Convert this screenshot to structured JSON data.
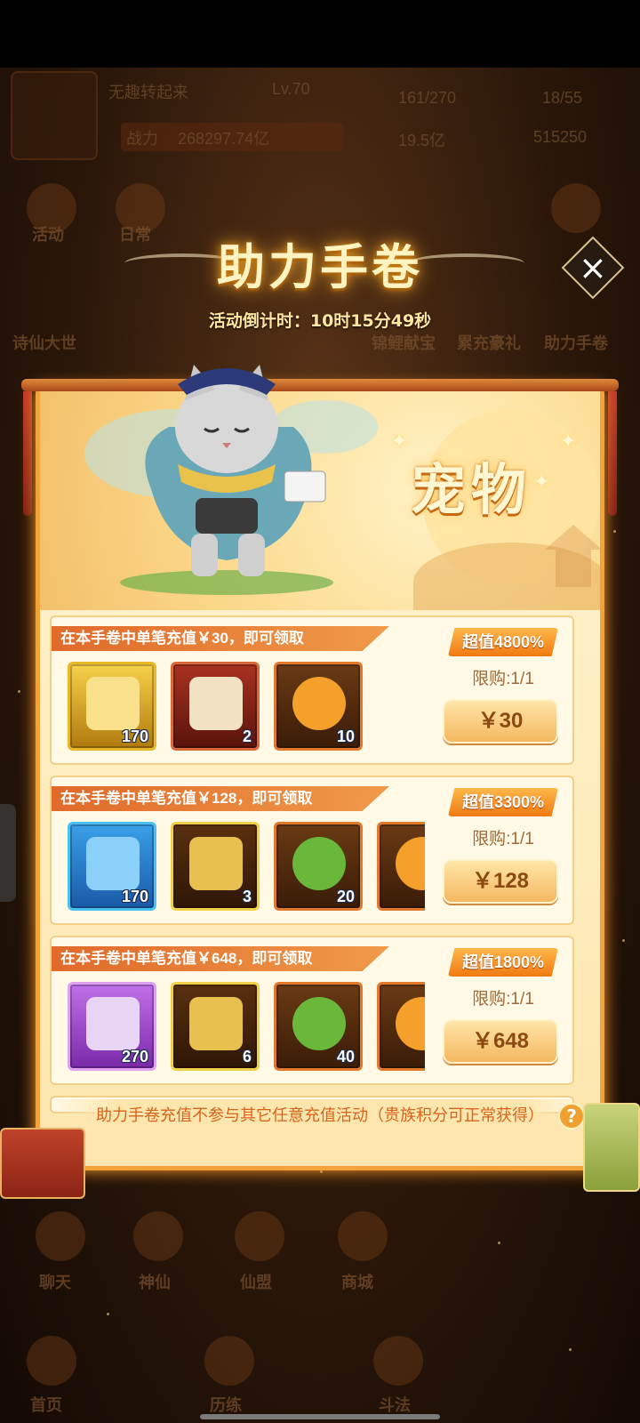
{
  "hud": {
    "player_name": "无趣转起来",
    "level": "Lv.70",
    "stamina": "161/270",
    "energy": "18/55",
    "power_label": "战力",
    "power_value": "268297.74亿",
    "currency_1": "19.5亿",
    "currency_2": "515250"
  },
  "background_labels": [
    "活动",
    "日常",
    "诗仙大世",
    "锦鲤献宝",
    "累充豪礼",
    "助力手卷",
    "聊天",
    "神仙",
    "仙盟",
    "商城",
    "首页",
    "历练",
    "斗法"
  ],
  "popup": {
    "title": "助力手卷",
    "countdown_label": "活动倒计时：",
    "countdown_value": "10时15分49秒",
    "close_icon": "×",
    "category": "宠物",
    "footer_note": "助力手卷充值不参与其它任意充值活动（贵族积分可正常获得）",
    "help_icon": "?"
  },
  "offers": [
    {
      "requirement": "在本手卷中单笔充值￥30，即可领取",
      "badge": "超值4800%",
      "limit": "限购:1/1",
      "price": "￥30",
      "items": [
        {
          "icon": "golden-chest-icon",
          "count": "170"
        },
        {
          "icon": "scroll-icon",
          "count": "2"
        },
        {
          "icon": "orange-slime-pet-icon",
          "count": "10"
        }
      ]
    },
    {
      "requirement": "在本手卷中单笔充值￥128，即可领取",
      "badge": "超值3300%",
      "limit": "限购:1/1",
      "price": "￥128",
      "items": [
        {
          "icon": "blue-chest-icon",
          "count": "170"
        },
        {
          "icon": "golden-scroll-icon",
          "count": "3"
        },
        {
          "icon": "green-herb-icon",
          "count": "20"
        },
        {
          "icon": "orange-slime-pet-icon",
          "count": ""
        }
      ]
    },
    {
      "requirement": "在本手卷中单笔充值￥648，即可领取",
      "badge": "超值1800%",
      "limit": "限购:1/1",
      "price": "￥648",
      "items": [
        {
          "icon": "purple-cat-chest-icon",
          "count": "270"
        },
        {
          "icon": "golden-scroll-icon",
          "count": "6"
        },
        {
          "icon": "green-herb-icon",
          "count": "40"
        },
        {
          "icon": "orange-slime-pet-icon",
          "count": ""
        }
      ]
    }
  ],
  "colors": {
    "accent_orange": "#f07a12",
    "panel_bg": "#fde6ae",
    "title_glow": "#ffb238"
  }
}
